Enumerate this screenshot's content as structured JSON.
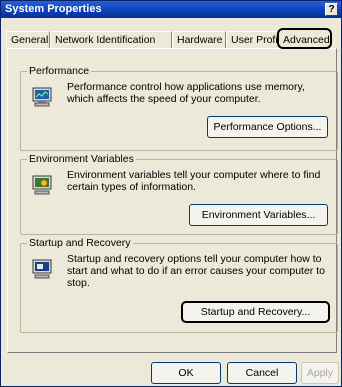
{
  "window": {
    "title": "System Properties",
    "help_label": "?"
  },
  "tabs": [
    {
      "label": "General"
    },
    {
      "label": "Network Identification"
    },
    {
      "label": "Hardware"
    },
    {
      "label": "User Profiles"
    },
    {
      "label": "Advanced"
    }
  ],
  "performance": {
    "title": "Performance",
    "text": "Performance control how applications use memory, which affects the speed of your computer.",
    "button": "Performance Options..."
  },
  "environment": {
    "title": "Environment Variables",
    "text": "Environment variables tell your computer where to find certain types of information.",
    "button": "Environment Variables..."
  },
  "startup": {
    "title": "Startup and Recovery",
    "text": "Startup and recovery options tell your computer how to start and what to do if an error causes your computer to stop.",
    "button": "Startup and Recovery..."
  },
  "footer": {
    "ok": "OK",
    "cancel": "Cancel",
    "apply": "Apply"
  }
}
